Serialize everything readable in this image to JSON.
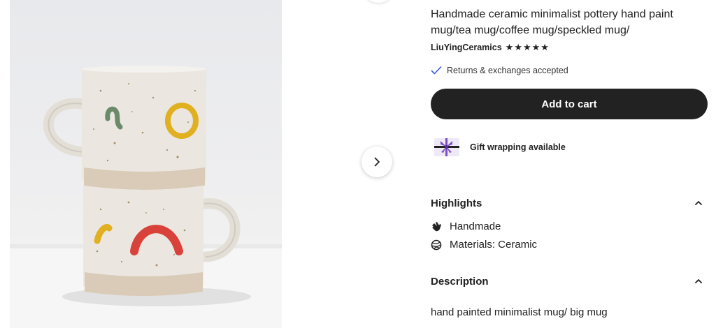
{
  "product": {
    "title": "Handmade ceramic minimalist pottery hand paint mug/tea mug/coffee mug/speckled mug/",
    "shop_name": "LiuYingCeramics",
    "rating_stars": 5,
    "star_glyph": "★",
    "returns_text": "Returns & exchanges accepted",
    "add_to_cart_label": "Add to cart",
    "gift_text": "Gift wrapping available"
  },
  "highlights": {
    "heading": "Highlights",
    "items": [
      {
        "icon": "hand-icon",
        "label": "Handmade"
      },
      {
        "icon": "yarn-ball-icon",
        "label": "Materials: Ceramic"
      }
    ]
  },
  "description": {
    "heading": "Description",
    "text": "hand painted minimalist mug/ big mug"
  },
  "colors": {
    "button_bg": "#222222",
    "check": "#3b5bdb",
    "gift_ribbon": "#7b4fc4",
    "mug_glaze": "#ebe7e0",
    "mug_clay": "#d9cbb8",
    "mark_yellow": "#e0b020",
    "mark_green": "#6b8a6a",
    "mark_red": "#d9413b"
  }
}
